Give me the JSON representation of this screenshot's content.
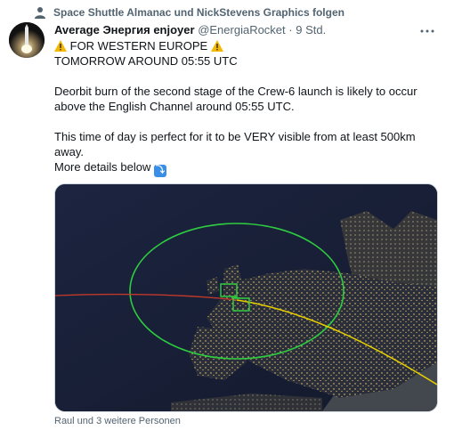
{
  "social_context": {
    "text": "Space Shuttle Almanac und NickStevens Graphics folgen",
    "icon": "person-icon"
  },
  "author": {
    "display_name": "Average Энергия enjoyer",
    "handle": "@EnergiaRocket",
    "separator": "·",
    "timestamp": "9 Std."
  },
  "more_icon": "more-icon",
  "text": {
    "line1": "FOR WESTERN EUROPE",
    "line2": "TOMORROW AROUND 05:55 UTC",
    "line3": "Deorbit burn of the second stage of the Crew-6 launch is likely to occur",
    "line4": "above the English Channel around 05:55 UTC.",
    "line5": "This time of day is perfect for it to be VERY visible from at least 500km",
    "line6": "away.",
    "line7": "More details below",
    "warning_icon": "warning-icon",
    "arrow_icon": "arrow-down-right-icon"
  },
  "liked_by": "Raul und 3 weitere Personen",
  "colors": {
    "accent": "#1d9bf0",
    "muted_text": "#536471",
    "visibility_circle": "#2ecc40",
    "ground_track_east": "#e8d000",
    "ground_track_west": "#c0392b"
  }
}
